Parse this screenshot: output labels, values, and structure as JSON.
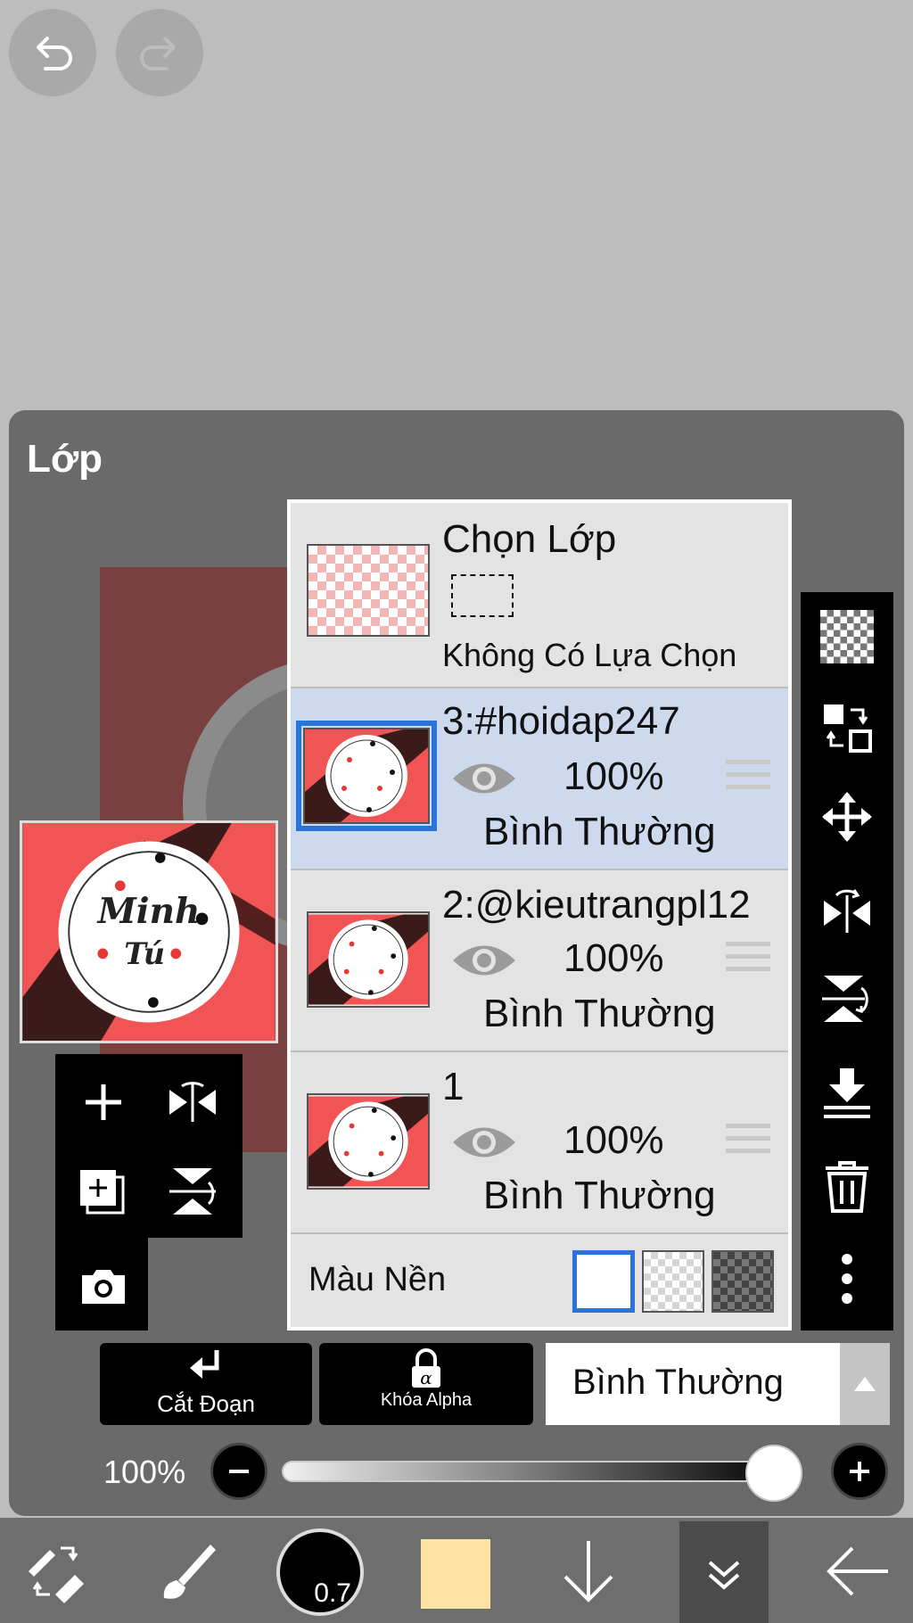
{
  "panel": {
    "title": "Lớp"
  },
  "selection_row": {
    "title": "Chọn Lớp",
    "status": "Không Có Lựa Chọn"
  },
  "layers": [
    {
      "name": "3:#hoidap247",
      "opacity": "100%",
      "blend": "Bình Thường",
      "selected": true
    },
    {
      "name": "2:@kieutrangpl12",
      "opacity": "100%",
      "blend": "Bình Thường",
      "selected": false
    },
    {
      "name": "1",
      "opacity": "100%",
      "blend": "Bình Thường",
      "selected": false
    }
  ],
  "background_color": {
    "label": "Màu Nền"
  },
  "artwork": {
    "line1": "Minh",
    "line2": "Tú"
  },
  "actions": {
    "clipping_label": "Cắt Đoạn",
    "alpha_lock_label": "Khóa Alpha",
    "blend_mode_value": "Bình Thường"
  },
  "opacity_slider": {
    "label": "100%",
    "value_percent": 100
  },
  "bottom_toolbar": {
    "brush_size_label": "0.7",
    "current_color": "#fde3a4"
  },
  "colors": {
    "accent_blue": "#2a74d9",
    "selected_row": "#cdd9ed",
    "artwork_red": "#f05454"
  }
}
